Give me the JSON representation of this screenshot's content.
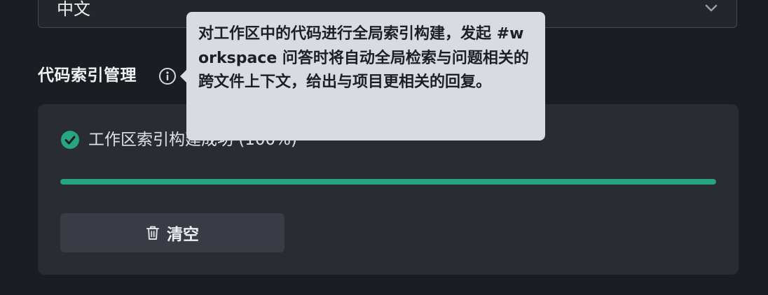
{
  "language_select": {
    "value": "中文",
    "icon": "chevron-down-icon"
  },
  "code_index": {
    "title": "代码索引管理",
    "info_icon": "info-icon",
    "status_icon": "check-circle-icon",
    "status_text": "工作区索引构建成功 (100%)",
    "progress": 1.0,
    "progress_color": "#27a57e",
    "clear_button": {
      "label": "清空",
      "icon": "trash-icon"
    }
  },
  "tooltip": {
    "text": "对工作区中的代码进行全局索引构建，发起 #workspace 问答时将自动全局检索与问题相关的跨文件上下文，给出与项目更相关的回复。"
  },
  "colors": {
    "background": "#1c1d22",
    "card": "#2a2c33",
    "tooltip": "#d9dbe1",
    "accent": "#27a57e"
  }
}
